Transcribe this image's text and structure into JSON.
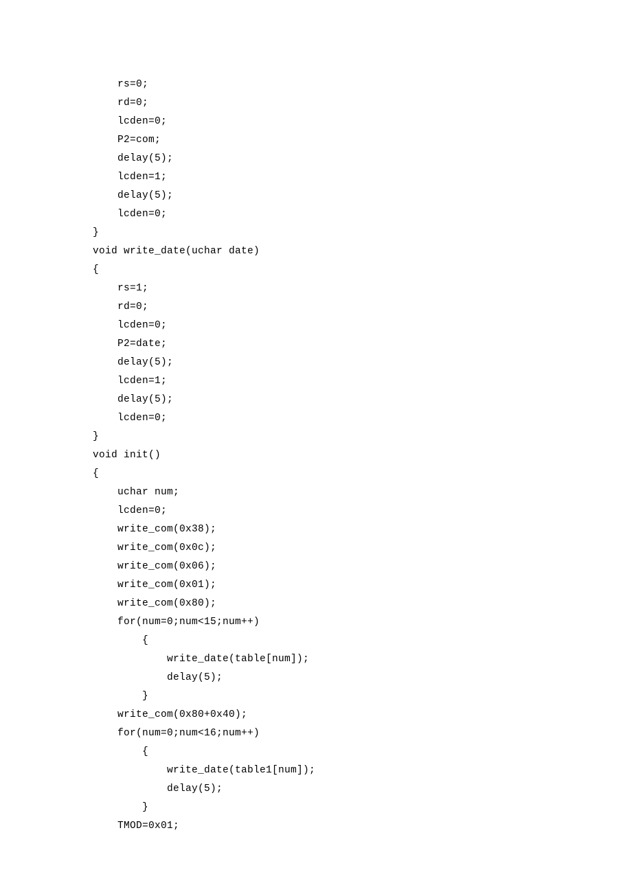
{
  "code": {
    "lines": [
      "    rs=0;",
      "    rd=0;",
      "    lcden=0;",
      "    P2=com;",
      "    delay(5);",
      "    lcden=1;",
      "    delay(5);",
      "    lcden=0;",
      "}",
      "",
      "void write_date(uchar date)",
      "{",
      "    rs=1;",
      "    rd=0;",
      "    lcden=0;",
      "    P2=date;",
      "    delay(5);",
      "    lcden=1;",
      "    delay(5);",
      "    lcden=0;",
      "}",
      "",
      "void init()",
      "{",
      "    uchar num;",
      "    lcden=0;",
      "",
      "    write_com(0x38);",
      "    write_com(0x0c);",
      "    write_com(0x06);",
      "    write_com(0x01);",
      "    write_com(0x80);",
      "    for(num=0;num<15;num++)",
      "        {",
      "            write_date(table[num]);",
      "            delay(5);",
      "        }",
      "    write_com(0x80+0x40);",
      "    for(num=0;num<16;num++)",
      "        {",
      "            write_date(table1[num]);",
      "            delay(5);",
      "        }",
      "    TMOD=0x01;"
    ]
  }
}
